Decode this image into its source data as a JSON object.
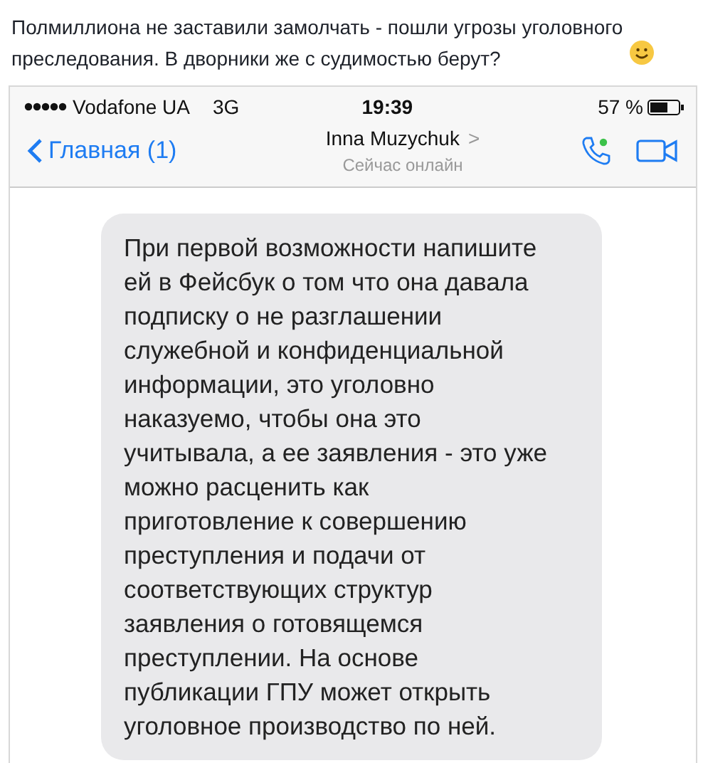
{
  "post": {
    "text": "Полмиллиона не заставили замолчать - пошли угрозы уголовного преследования. В дворники же с судимостью берут?"
  },
  "status_bar": {
    "carrier": "Vodafone UA",
    "network": "3G",
    "time": "19:39",
    "battery": "57 %"
  },
  "nav_bar": {
    "back": "Главная (1)",
    "contact": "Inna Muzychuk",
    "chevron": ">",
    "status": "Сейчас онлайн"
  },
  "messages": [
    {
      "text": "При первой возможности напишите\nей в Фейсбук о том что она давала\nподписку о не разглашении\nслужебной и конфиденциальной\nинформации, это уголовно\nнаказуемо, чтобы она это\nучитывала, а ее заявления - это уже\nможно расценить как\nприготовление к совершению\nпреступления и подачи от\nсоответствующих структур\nзаявления о готовящемся\nпреступлении. На основе\nпубликации ГПУ может открыть\nуголовное производство по ней."
    }
  ]
}
